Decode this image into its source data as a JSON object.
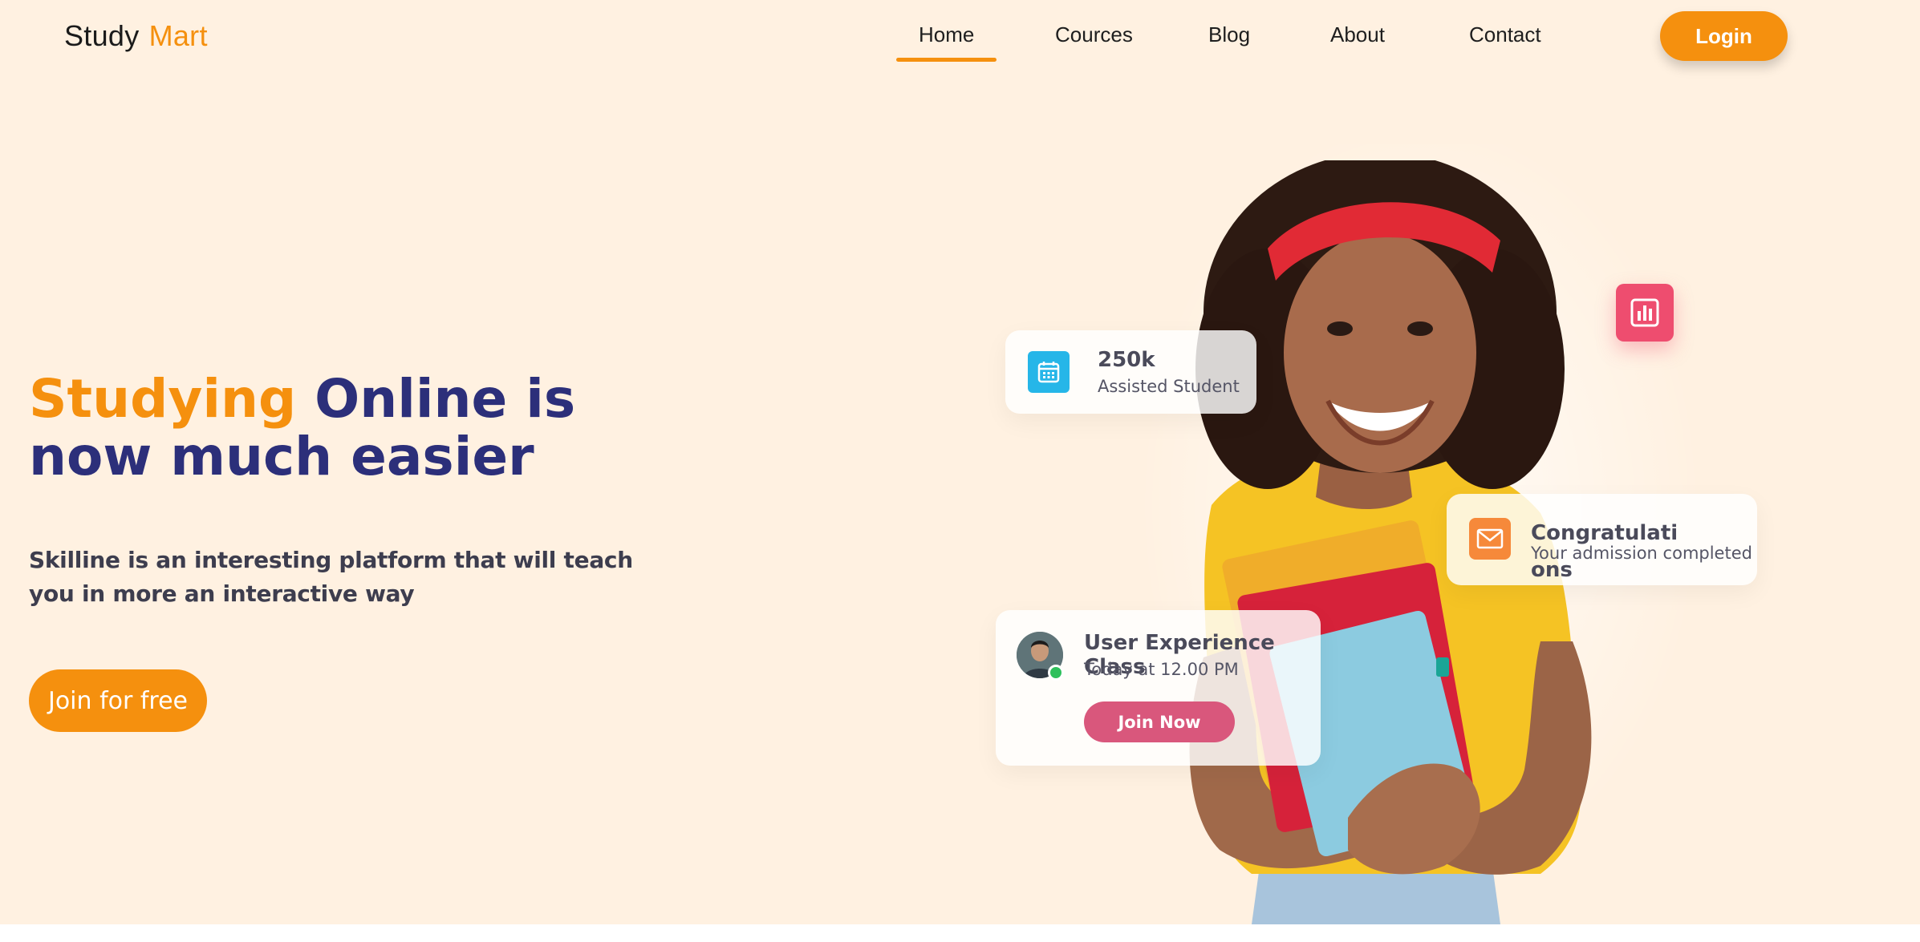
{
  "brand": {
    "first": "Study",
    "second": "Mart",
    "accent_color": "#f5900e"
  },
  "nav": {
    "items": [
      {
        "label": "Home",
        "active": true
      },
      {
        "label": "Cources",
        "active": false
      },
      {
        "label": "Blog",
        "active": false
      },
      {
        "label": "About",
        "active": false
      },
      {
        "label": "Contact",
        "active": false
      }
    ],
    "login_label": "Login"
  },
  "hero": {
    "title_highlight": "Studying",
    "title_rest": " Online is now much easier",
    "subtitle": "Skilline is an interesting platform that will teach you in more an interactive way",
    "cta_label": "Join for free"
  },
  "cards": {
    "stat": {
      "value": "250k",
      "label": "Assisted Student",
      "icon": "calendar-icon"
    },
    "chart_badge": {
      "icon": "bar-chart-icon"
    },
    "congrats": {
      "title": "Congratulati ons",
      "text": "Your admission completed",
      "icon": "mail-icon"
    },
    "class": {
      "title": "User Experience Class",
      "time": "Today at 12.00 PM",
      "button_label": "Join Now"
    }
  },
  "colors": {
    "background": "#fff1e1",
    "heading": "#2c2f7a",
    "blue_icon": "#26b6e8",
    "pink": "#ee4d6f",
    "join_now": "#d9577c",
    "online": "#2ec05c"
  }
}
